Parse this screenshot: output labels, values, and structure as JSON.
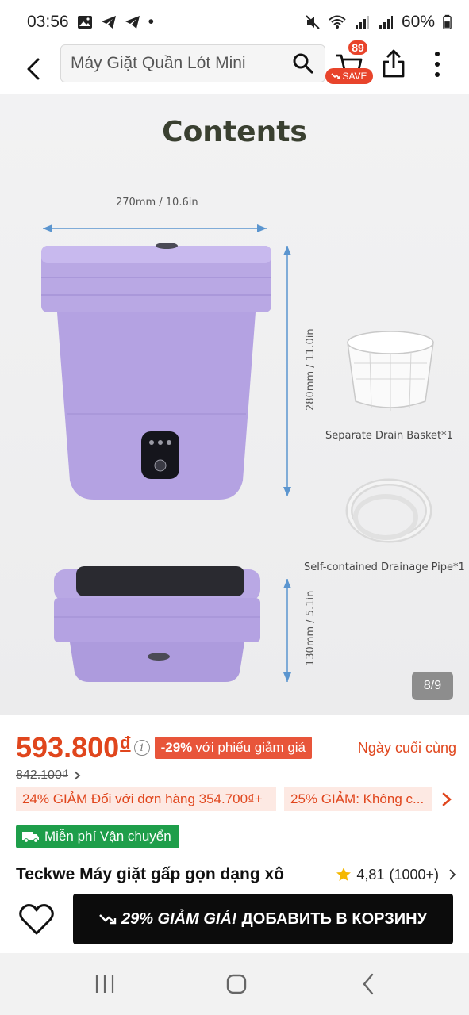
{
  "status_bar": {
    "time": "03:56",
    "dot": "•",
    "battery": "60%"
  },
  "header": {
    "search_text": "Máy Giặt Quần Lót Mini",
    "cart_count": "89",
    "save_label": "SAVE"
  },
  "product_image": {
    "title": "Contents",
    "width_label": "270mm / 10.6in",
    "height_label": "280mm / 11.0in",
    "folded_height_label": "130mm / 5.1in",
    "accessory_1": "Separate Drain Basket*1",
    "accessory_2": "Self-contained Drainage Pipe*1",
    "counter": "8/9"
  },
  "pricing": {
    "price": "593.800",
    "currency": "đ",
    "discount_percent": "-29%",
    "discount_text": "với phiếu giảm giá",
    "last_day": "Ngày cuối cùng",
    "original_price": "842.100₫"
  },
  "coupons": [
    "24% GIẢM Đối với đơn hàng 354.700₫+",
    "25% GIẢM: Không c..."
  ],
  "shipping": {
    "label": "Miễn phí Vận chuyển"
  },
  "product": {
    "title": "Teckwe Máy giặt gấp gọn dạng xô",
    "rating": "4,81",
    "review_count": "(1000+)"
  },
  "action_bar": {
    "promo": "29% GIẢM GIÁ!",
    "cta": "ДОБАВИТЬ В КОРЗИНУ"
  },
  "colors": {
    "accent": "#e0461d",
    "shipping_green": "#1e9e4a",
    "cta_bg": "#0c0c0c",
    "machine_purple": "#b3a1df"
  }
}
